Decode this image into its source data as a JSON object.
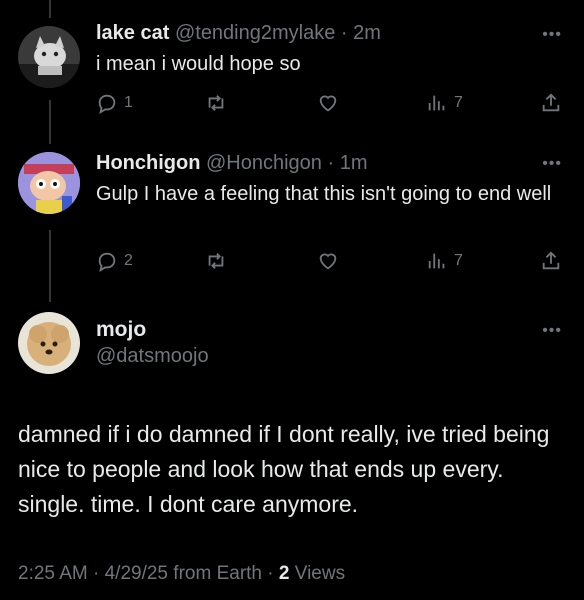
{
  "replies": [
    {
      "name": "lake cat",
      "handle": "@tending2mylake",
      "separator": "·",
      "time": "2m",
      "text": "i mean  i would hope so",
      "replies_count": "1",
      "views_count": "7"
    },
    {
      "name": "Honchigon",
      "handle": "@Honchigon",
      "separator": "·",
      "time": "1m",
      "text": "Gulp I have a feeling that this isn't going to end well",
      "replies_count": "2",
      "views_count": "7"
    }
  ],
  "main_post": {
    "name": "mojo",
    "handle": "@datsmoojo",
    "text": "damned if i do damned if I dont really, ive tried being nice to people and look how that ends up every. single. time. I dont care anymore.",
    "time": "2:25 AM",
    "date": "4/29/25",
    "source": "from Earth",
    "views_count": "2",
    "views_label": "Views",
    "separator": "·"
  },
  "more_glyph": "•••",
  "icons": [
    "reply-icon",
    "repost-icon",
    "like-icon",
    "views-icon",
    "share-icon",
    "more-icon"
  ]
}
